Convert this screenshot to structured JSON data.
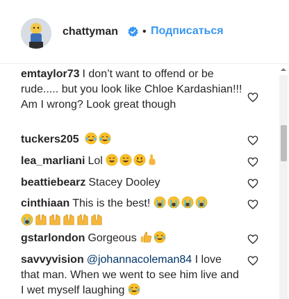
{
  "header": {
    "username": "chattyman",
    "separator": "•",
    "follow_label": "Подписаться"
  },
  "comments": [
    {
      "user": "emtaylor73",
      "text": "I don’t want to offend or be rude..... but you look like Chloe Kardashian!!! Am I wrong? Look great though",
      "emojis": []
    },
    {
      "user": "tuckers205",
      "text": "",
      "emojis": [
        "laughing-crying",
        "laughing-crying"
      ]
    },
    {
      "user": "lea_marliani",
      "text": "Lol",
      "emojis": [
        "laughing",
        "laughing",
        "grinning",
        "pointing-up-hand"
      ]
    },
    {
      "user": "beattiebearz",
      "text": "Stacey Dooley",
      "emojis": []
    },
    {
      "user": "cinthiaan",
      "text": "This is the best!",
      "emojis": [
        "crying",
        "crying",
        "crying",
        "crying",
        "crying",
        "raising-hands",
        "raising-hands",
        "raising-hands",
        "raising-hands",
        "raising-hands"
      ]
    },
    {
      "user": "gstarlondon",
      "text": "Gorgeous",
      "emojis": [
        "thumbs-up",
        "laughing-crying"
      ]
    },
    {
      "user": "savvyvision",
      "mention": "@johannacoleman84",
      "text": "I love that man. When we went to see him live and I wet myself laughing",
      "emojis": [
        "laughing-crying"
      ]
    }
  ],
  "icons": {
    "verified": "verified-badge-icon",
    "like": "heart-outline-icon"
  },
  "colors": {
    "link": "#3897f0",
    "text": "#262626",
    "mention": "#003569",
    "emoji": "#fbc02d"
  }
}
